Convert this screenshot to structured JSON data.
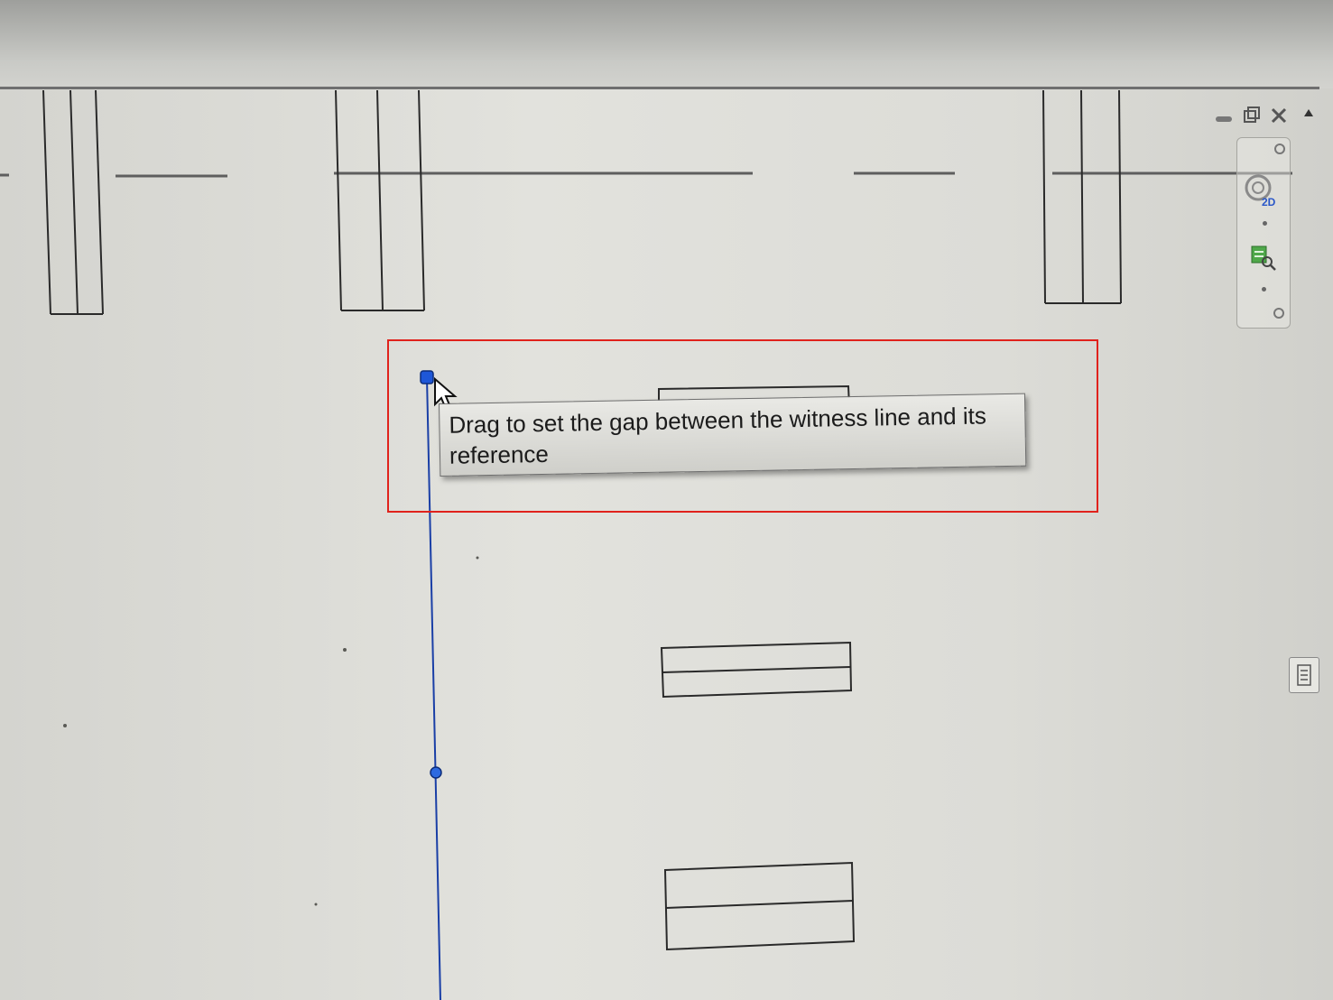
{
  "tooltip": {
    "text": "Drag to set the gap between the witness line and its reference"
  },
  "window_controls": {
    "minimize_icon": "minimize-icon",
    "restore_icon": "restore-icon",
    "close_icon": "close-icon",
    "collapse_icon": "collapse-arrow-icon"
  },
  "view_toolbar": {
    "icons": [
      "view-2d-icon",
      "zoom-sheet-icon"
    ],
    "badge_2d": "2D"
  },
  "colors": {
    "highlight": "#e0221c",
    "selection": "#1a3fa6",
    "drawing_line": "#2a2a2a"
  }
}
